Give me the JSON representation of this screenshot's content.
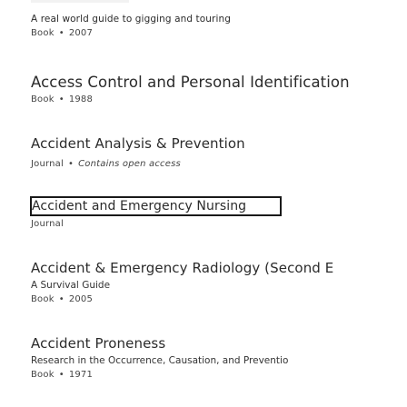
{
  "results": [
    {
      "title": "A real world guide to gigging and touring",
      "type": "Book",
      "year": "2007"
    },
    {
      "title": "Access Control and Personal Identification",
      "type": "Book",
      "year": "1988"
    },
    {
      "title": "Accident Analysis & Prevention",
      "type": "Journal",
      "access": "Contains open access"
    },
    {
      "title": "Accident and Emergency Nursing",
      "type": "Journal"
    },
    {
      "title": "Accident & Emergency Radiology (Second E",
      "subtitle": "A Survival Guide",
      "type": "Book",
      "year": "2005"
    },
    {
      "title": "Accident Proneness",
      "subtitle": "Research in the Occurrence, Causation, and Preventio",
      "type": "Book",
      "year": "1971"
    }
  ],
  "separator": "•"
}
